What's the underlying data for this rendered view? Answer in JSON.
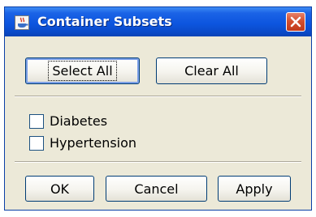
{
  "window": {
    "title": "Container Subsets",
    "icon": "java-cup-icon",
    "close_icon": "close-icon"
  },
  "top_buttons": {
    "select_all": "Select All",
    "clear_all": "Clear All"
  },
  "subsets": [
    {
      "label": "Diabetes",
      "checked": false
    },
    {
      "label": "Hypertension",
      "checked": false
    }
  ],
  "bottom_buttons": {
    "ok": "OK",
    "cancel": "Cancel",
    "apply": "Apply"
  },
  "colors": {
    "title_bar": "#0d56df",
    "window_bg": "#ece9d8",
    "close_button": "#d4502f"
  }
}
